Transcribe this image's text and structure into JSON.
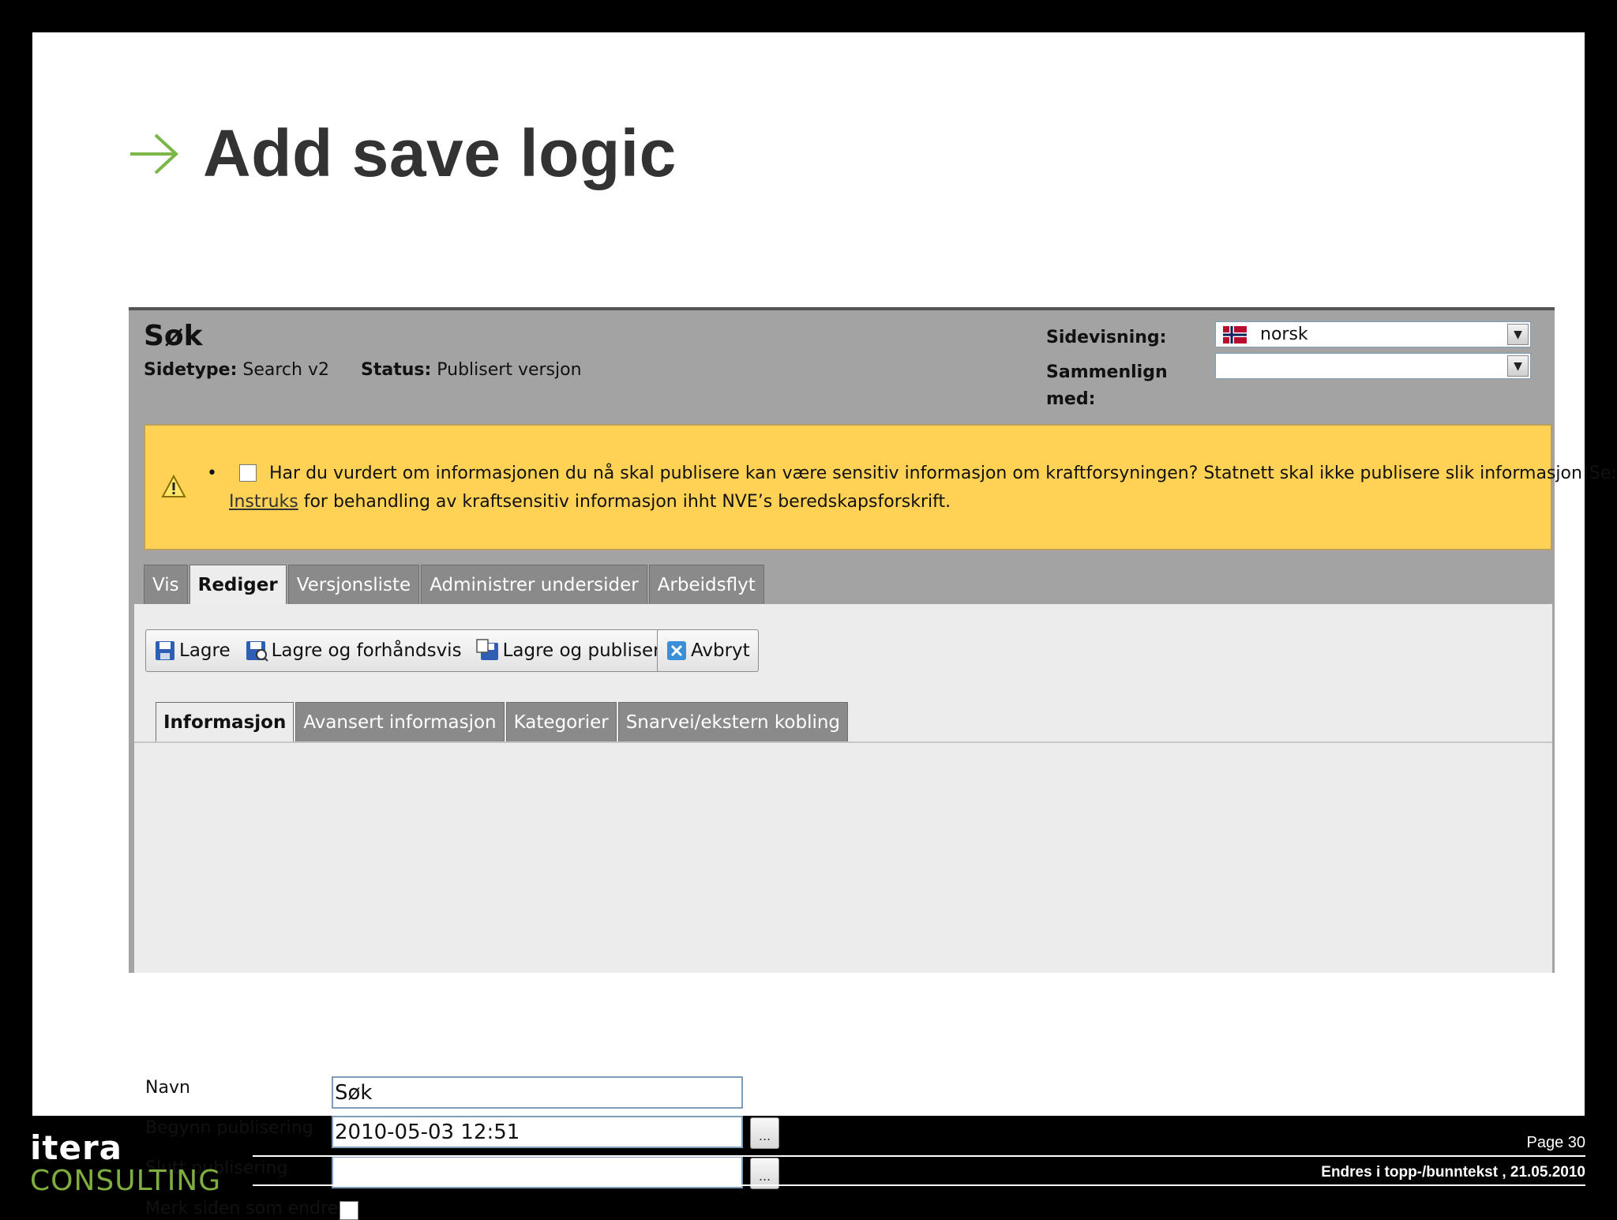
{
  "slide": {
    "title": "Add save logic",
    "page_number": "Page 30",
    "footer_text": "Endres i topp-/bunntekst , 21.05.2010",
    "logo_top": "itera",
    "logo_bottom": "CONSULTING",
    "arrow_color": "#7ab648"
  },
  "page_header": {
    "title": "Søk",
    "sidetype_label": "Sidetype:",
    "sidetype_value": "Search v2",
    "status_label": "Status:",
    "status_value": "Publisert versjon",
    "sidevisning_label": "Sidevisning:",
    "sidevisning_value": "norsk",
    "sammenlign_label": "Sammenlign med:",
    "sammenlign_value": ""
  },
  "warning": {
    "bullet": "•",
    "line1": "Har du vurdert om informasjonen du nå skal publisere kan være sensitiv informasjon om kraftforsyningen? Statnett skal ikke publisere slik informasjon!Se:",
    "link": "Instruks",
    "line2_rest": " for behandling av kraftsensitiv informasjon ihht NVE’s beredskapsforskrift.",
    "bg_color": "#ffd154"
  },
  "main_tabs": [
    {
      "label": "Vis",
      "active": false
    },
    {
      "label": "Rediger",
      "active": true
    },
    {
      "label": "Versjonsliste",
      "active": false
    },
    {
      "label": "Administrer undersider",
      "active": false
    },
    {
      "label": "Arbeidsflyt",
      "active": false
    }
  ],
  "toolbar": {
    "save": "Lagre",
    "save_preview": "Lagre og forhåndsvis",
    "save_publish": "Lagre og publiser",
    "cancel": "Avbryt"
  },
  "sub_tabs": [
    {
      "label": "Informasjon",
      "active": true
    },
    {
      "label": "Avansert informasjon",
      "active": false
    },
    {
      "label": "Kategorier",
      "active": false
    },
    {
      "label": "Snarvei/ekstern kobling",
      "active": false
    }
  ],
  "form": {
    "navn_label": "Navn",
    "navn_value": "Søk",
    "begynn_label": "Begynn publisering",
    "begynn_value": "2010-05-03 12:51",
    "slutt_label": "Slutt publisering",
    "slutt_value": "",
    "merk_label": "Merk siden som endret",
    "dots": "..."
  }
}
